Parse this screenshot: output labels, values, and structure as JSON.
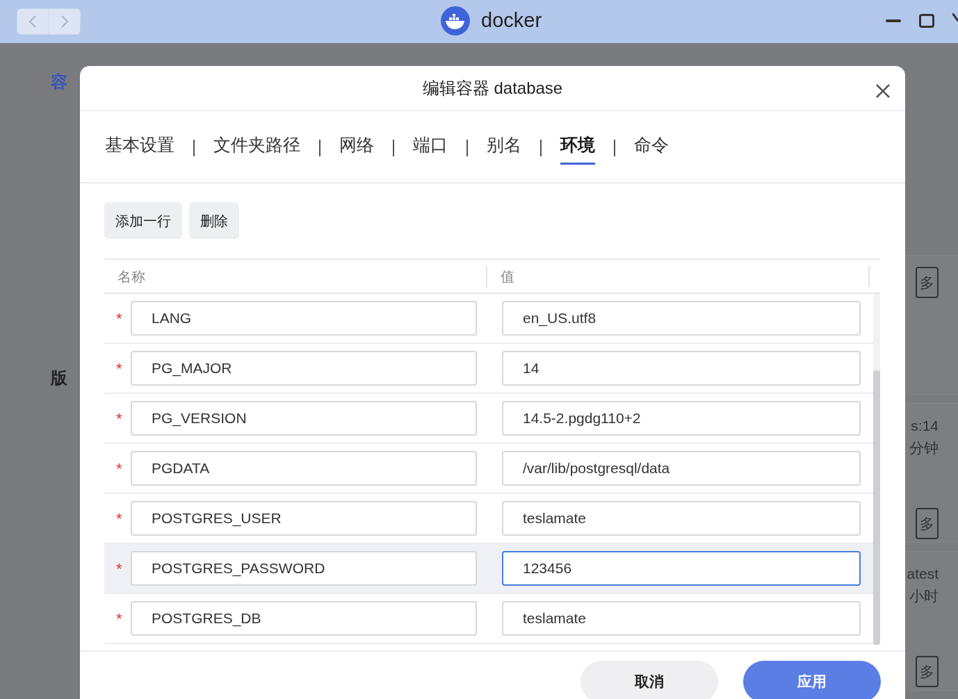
{
  "app": {
    "title": "docker"
  },
  "sidebar": {
    "items": [
      {
        "label": "容",
        "selected": true
      },
      {
        "label": "版",
        "selected": false
      }
    ]
  },
  "background_cards": [
    {
      "button": "多"
    },
    {
      "lines": [
        "s:14",
        "分钟"
      ],
      "button": "多"
    },
    {
      "lines": [
        "atest",
        "小时"
      ],
      "button": "多"
    }
  ],
  "dialog": {
    "title": "编辑容器 database",
    "tabs": [
      {
        "label": "基本设置",
        "selected": false
      },
      {
        "label": "文件夹路径",
        "selected": false
      },
      {
        "label": "网络",
        "selected": false
      },
      {
        "label": "端口",
        "selected": false
      },
      {
        "label": "别名",
        "selected": false
      },
      {
        "label": "环境",
        "selected": true
      },
      {
        "label": "命令",
        "selected": false
      }
    ],
    "toolbar": [
      "添加一行",
      "删除"
    ],
    "table": {
      "columns": [
        "名称",
        "值"
      ],
      "rows": [
        {
          "required": "*",
          "name": "LANG",
          "value": "en_US.utf8",
          "selected": false
        },
        {
          "required": "*",
          "name": "PG_MAJOR",
          "value": "14",
          "selected": false
        },
        {
          "required": "*",
          "name": "PG_VERSION",
          "value": "14.5-2.pgdg110+2",
          "selected": false
        },
        {
          "required": "*",
          "name": "PGDATA",
          "value": "/var/lib/postgresql/data",
          "selected": false
        },
        {
          "required": "*",
          "name": "POSTGRES_USER",
          "value": "teslamate",
          "selected": false
        },
        {
          "required": "*",
          "name": "POSTGRES_PASSWORD",
          "value": "123456",
          "selected": true
        },
        {
          "required": "*",
          "name": "POSTGRES_DB",
          "value": "teslamate",
          "selected": false
        }
      ]
    },
    "buttons": [
      {
        "label": "取消",
        "kind": "secondary"
      },
      {
        "label": "应用",
        "kind": "primary"
      }
    ]
  }
}
